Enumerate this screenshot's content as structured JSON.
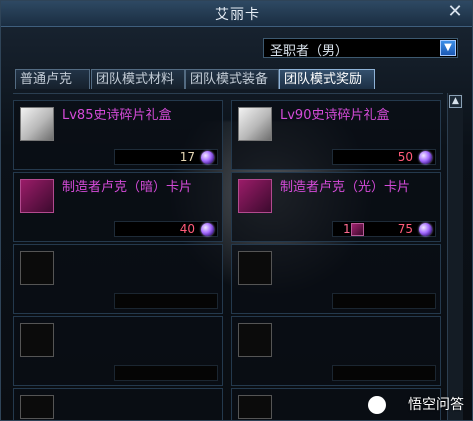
{
  "window": {
    "title": "艾丽卡",
    "close_icon": "close-icon"
  },
  "filter": {
    "selected": "圣职者（男）",
    "dropdown_icon": "chevron-down-icon"
  },
  "tabs": [
    {
      "label": "普通卢克"
    },
    {
      "label": "团队模式材料"
    },
    {
      "label": "团队模式装备"
    },
    {
      "label": "团队模式奖励"
    }
  ],
  "active_tab": "团队模式奖励",
  "items": [
    {
      "name": "Lv85史诗碎片礼盒",
      "count": "17",
      "count_color": "#e6d7b5",
      "icon": "gift-box-icon"
    },
    {
      "name": "Lv90史诗碎片礼盒",
      "count": "50",
      "count_color": "#ff5b7a",
      "icon": "gift-box-icon"
    },
    {
      "name": "制造者卢克（暗）卡片",
      "count": "40",
      "count_color": "#ff5b7a",
      "icon": "card-icon"
    },
    {
      "name": "制造者卢克（光）卡片",
      "count": "75",
      "count_color": "#ff5b7a",
      "extra_count": "1",
      "icon": "card-icon"
    }
  ],
  "scroll": {
    "up_icon": "chevron-up-icon"
  },
  "watermark": {
    "text": "悟空问答"
  }
}
